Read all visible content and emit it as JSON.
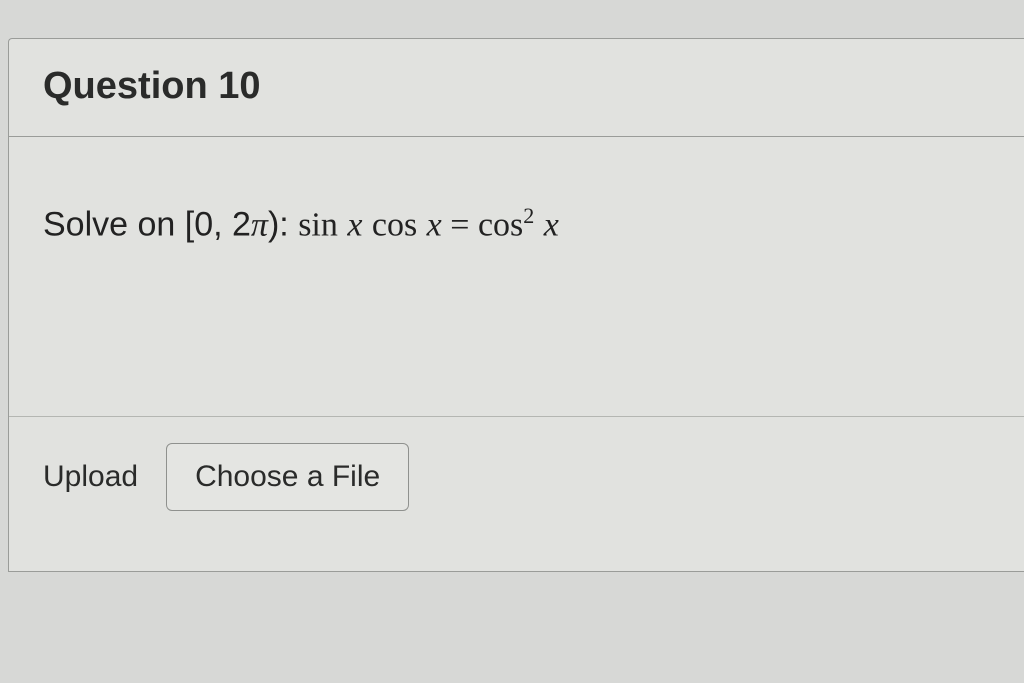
{
  "question": {
    "title": "Question 10",
    "prompt_prefix": "Solve on [0, 2",
    "prompt_pi": "π",
    "prompt_close": "):  ",
    "eq_sin": "sin",
    "eq_x1": "x",
    "eq_cos1": "cos",
    "eq_x2": "x",
    "eq_equals": " = ",
    "eq_cos2": "cos",
    "eq_sup": "2",
    "eq_x3": "x"
  },
  "upload": {
    "label": "Upload",
    "button": "Choose a File"
  }
}
